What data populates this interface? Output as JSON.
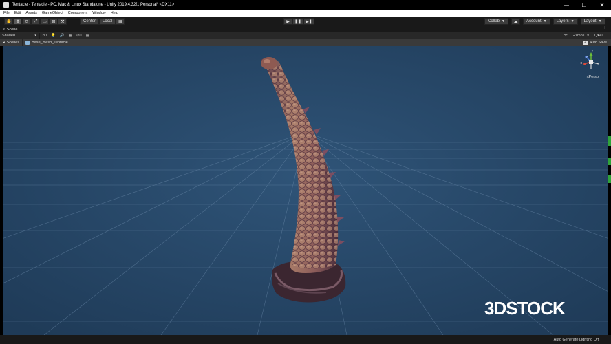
{
  "window": {
    "title": "Tentacle - Tentacle - PC, Mac & Linux Standalone - Unity 2019.4.32f1 Personal* <DX11>",
    "controls": [
      "—",
      "☐",
      "✕"
    ]
  },
  "menu": [
    "File",
    "Edit",
    "Assets",
    "GameObject",
    "Component",
    "Window",
    "Help"
  ],
  "toolbar": {
    "tools": [
      "✋",
      "✥",
      "⟳",
      "⤢",
      "▭",
      "⊞",
      "⚒"
    ],
    "pivot": "Center",
    "space": "Local",
    "play": "▶",
    "pause": "❚❚",
    "step": "▶❚",
    "collab": "Collab",
    "cloud": "☁",
    "account": "Account",
    "layers": "Layers",
    "layout": "Layout"
  },
  "scene_tab": {
    "hash": "#",
    "label": "Scene",
    "menu": "⋮"
  },
  "scene_toolbar": {
    "shading": "Shaded",
    "mode_2d": "2D",
    "light": "💡",
    "audio": "🔊",
    "fx": "▦",
    "hidden": "⊘0",
    "grid": "▦",
    "tools_icon": "⚒",
    "gizmos": "Gizmos",
    "search": "Q▾All"
  },
  "breadcrumb": {
    "root": "Scenes",
    "object": "Base_mesh_Tentacle",
    "autosave": "Auto Save",
    "autosave_checked": "✓"
  },
  "viewport": {
    "persp": "≤Persp",
    "axis_y": "y",
    "axis_x": "x",
    "axis_z": "z",
    "bg_color": "#2a4a6c"
  },
  "watermark": {
    "part1": "3D",
    "part2": "STOCK"
  },
  "status": {
    "text": "Auto Generate Lighting Off"
  }
}
